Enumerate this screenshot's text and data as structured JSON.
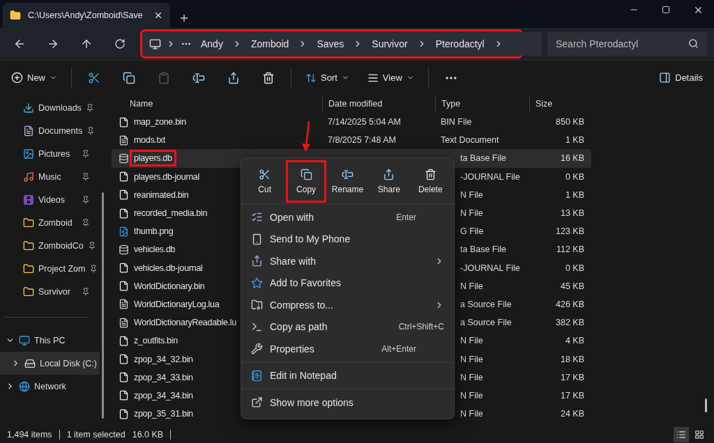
{
  "tab": {
    "title": "C:\\Users\\Andy\\Zomboid\\Save"
  },
  "address": {
    "highlighted": true,
    "crumbs": [
      "Andy",
      "Zomboid",
      "Saves",
      "Survivor",
      "Pterodactyl"
    ]
  },
  "search": {
    "placeholder": "Search Pterodactyl"
  },
  "toolbar": {
    "new": "New",
    "sort": "Sort",
    "view": "View",
    "details": "Details"
  },
  "sidebar": {
    "quick_access": [
      {
        "label": "Downloads",
        "kind": "download",
        "pinned": true
      },
      {
        "label": "Documents",
        "kind": "document",
        "pinned": true
      },
      {
        "label": "Pictures",
        "kind": "picture",
        "pinned": true
      },
      {
        "label": "Music",
        "kind": "music",
        "pinned": true
      },
      {
        "label": "Videos",
        "kind": "video",
        "pinned": true
      },
      {
        "label": "Zomboid",
        "kind": "folder",
        "pinned": true
      },
      {
        "label": "ZomboidCo",
        "kind": "folder",
        "pinned": true
      },
      {
        "label": "Project Zom",
        "kind": "folder",
        "pinned": true
      },
      {
        "label": "Survivor",
        "kind": "folder",
        "pinned": true
      }
    ],
    "tree": [
      {
        "label": "This PC",
        "kind": "pc",
        "expanded": true,
        "selected": false,
        "children": [
          {
            "label": "Local Disk (C:)",
            "kind": "disk",
            "expanded": false,
            "selected": true
          }
        ]
      },
      {
        "label": "Network",
        "kind": "network",
        "expanded": false,
        "selected": false
      }
    ]
  },
  "table": {
    "columns": [
      "Name",
      "Date modified",
      "Type",
      "Size"
    ],
    "rows": [
      {
        "name": "map_zone.bin",
        "kind": "blank",
        "date": "7/14/2025 5:04 AM",
        "type": "BIN File",
        "size": "850 KB",
        "selected": false,
        "highlighted": false
      },
      {
        "name": "mods.txt",
        "kind": "text",
        "date": "7/8/2025 7:48 AM",
        "type": "Text Document",
        "size": "1 KB",
        "selected": false,
        "highlighted": false
      },
      {
        "name": "players.db",
        "kind": "db",
        "type": "ta Base File",
        "size": "16 KB",
        "selected": true,
        "highlighted": true
      },
      {
        "name": "players.db-journal",
        "kind": "blank",
        "type": "-JOURNAL File",
        "size": "0 KB",
        "selected": false,
        "highlighted": false
      },
      {
        "name": "reanimated.bin",
        "kind": "blank",
        "type": "N File",
        "size": "1 KB",
        "selected": false,
        "highlighted": false
      },
      {
        "name": "recorded_media.bin",
        "kind": "blank",
        "type": "N File",
        "size": "13 KB",
        "selected": false,
        "highlighted": false
      },
      {
        "name": "thumb.png",
        "kind": "image",
        "type": "G File",
        "size": "123 KB",
        "selected": false,
        "highlighted": false
      },
      {
        "name": "vehicles.db",
        "kind": "db",
        "type": "ta Base File",
        "size": "112 KB",
        "selected": false,
        "highlighted": false
      },
      {
        "name": "vehicles.db-journal",
        "kind": "blank",
        "type": "-JOURNAL File",
        "size": "0 KB",
        "selected": false,
        "highlighted": false
      },
      {
        "name": "WorldDictionary.bin",
        "kind": "blank",
        "type": "N File",
        "size": "45 KB",
        "selected": false,
        "highlighted": false
      },
      {
        "name": "WorldDictionaryLog.lua",
        "kind": "text",
        "type": "a Source File",
        "size": "426 KB",
        "selected": false,
        "highlighted": false
      },
      {
        "name": "WorldDictionaryReadable.lu",
        "kind": "text",
        "type": "a Source File",
        "size": "382 KB",
        "selected": false,
        "highlighted": false
      },
      {
        "name": "z_outfits.bin",
        "kind": "blank",
        "type": "N File",
        "size": "4 KB",
        "selected": false,
        "highlighted": false
      },
      {
        "name": "zpop_34_32.bin",
        "kind": "blank",
        "type": "N File",
        "size": "18 KB",
        "selected": false,
        "highlighted": false
      },
      {
        "name": "zpop_34_33.bin",
        "kind": "blank",
        "type": "N File",
        "size": "17 KB",
        "selected": false,
        "highlighted": false
      },
      {
        "name": "zpop_34_34.bin",
        "kind": "blank",
        "type": "N File",
        "size": "17 KB",
        "selected": false,
        "highlighted": false
      },
      {
        "name": "zpop_35_31.bin",
        "kind": "blank",
        "type": "N File",
        "size": "24 KB",
        "selected": false,
        "highlighted": false
      }
    ]
  },
  "context_menu": {
    "actions": [
      {
        "label": "Cut",
        "kind": "cut",
        "highlighted": false
      },
      {
        "label": "Copy",
        "kind": "copy",
        "highlighted": true
      },
      {
        "label": "Rename",
        "kind": "rename",
        "highlighted": false
      },
      {
        "label": "Share",
        "kind": "share",
        "highlighted": false
      },
      {
        "label": "Delete",
        "kind": "delete",
        "highlighted": false
      }
    ],
    "sections": [
      [
        {
          "label": "Open with",
          "kind": "openwith",
          "shortcut": "Enter",
          "submenu": false
        },
        {
          "label": "Send to My Phone",
          "kind": "phone",
          "submenu": false
        },
        {
          "label": "Share with",
          "kind": "share",
          "submenu": true
        },
        {
          "label": "Add to Favorites",
          "kind": "star",
          "submenu": false
        },
        {
          "label": "Compress to...",
          "kind": "compress",
          "submenu": true
        },
        {
          "label": "Copy as path",
          "kind": "path",
          "shortcut": "Ctrl+Shift+C",
          "submenu": false
        },
        {
          "label": "Properties",
          "kind": "wrench",
          "shortcut": "Alt+Enter",
          "submenu": false
        }
      ],
      [
        {
          "label": "Edit in Notepad",
          "kind": "notepad",
          "submenu": false
        }
      ],
      [
        {
          "label": "Show more options",
          "kind": "more",
          "submenu": false
        }
      ]
    ]
  },
  "status_bar": {
    "count": "1,494 items",
    "selection": "1 item selected",
    "size": "16.0 KB"
  },
  "view_modes": [
    {
      "kind": "details",
      "selected": true
    },
    {
      "kind": "tiles",
      "selected": false
    }
  ]
}
